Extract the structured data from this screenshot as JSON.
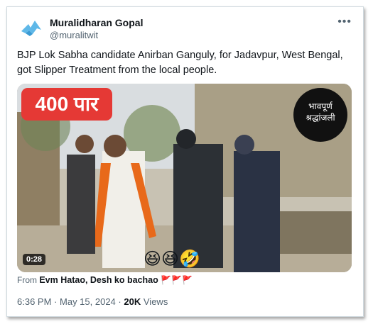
{
  "author": {
    "display_name": "Muralidharan Gopal",
    "handle": "@muralitwit"
  },
  "more_icon": "ellipsis-icon",
  "tweet_text": "BJP Lok Sabha candidate Anirban Ganguly, for Jadavpur, West Bengal, got Slipper Treatment from the local people.",
  "media": {
    "badge_text": "400 पार",
    "logo_text_line1": "भावपूर्ण",
    "logo_text_line2": "श्रद्धांजली",
    "duration": "0:28",
    "emojis": "😆😆🤣"
  },
  "source": {
    "prefix": "From",
    "account": "Evm Hatao, Desh ko bachao",
    "flags": "🚩🚩🚩"
  },
  "meta": {
    "time": "6:36 PM",
    "separator1": "·",
    "date": "May 15, 2024",
    "separator2": "·",
    "views_count": "20K",
    "views_label": "Views"
  },
  "colors": {
    "badge_red": "#e53935",
    "text_primary": "#0f1419",
    "text_secondary": "#536471",
    "avatar_blue": "#1d9bf0"
  }
}
